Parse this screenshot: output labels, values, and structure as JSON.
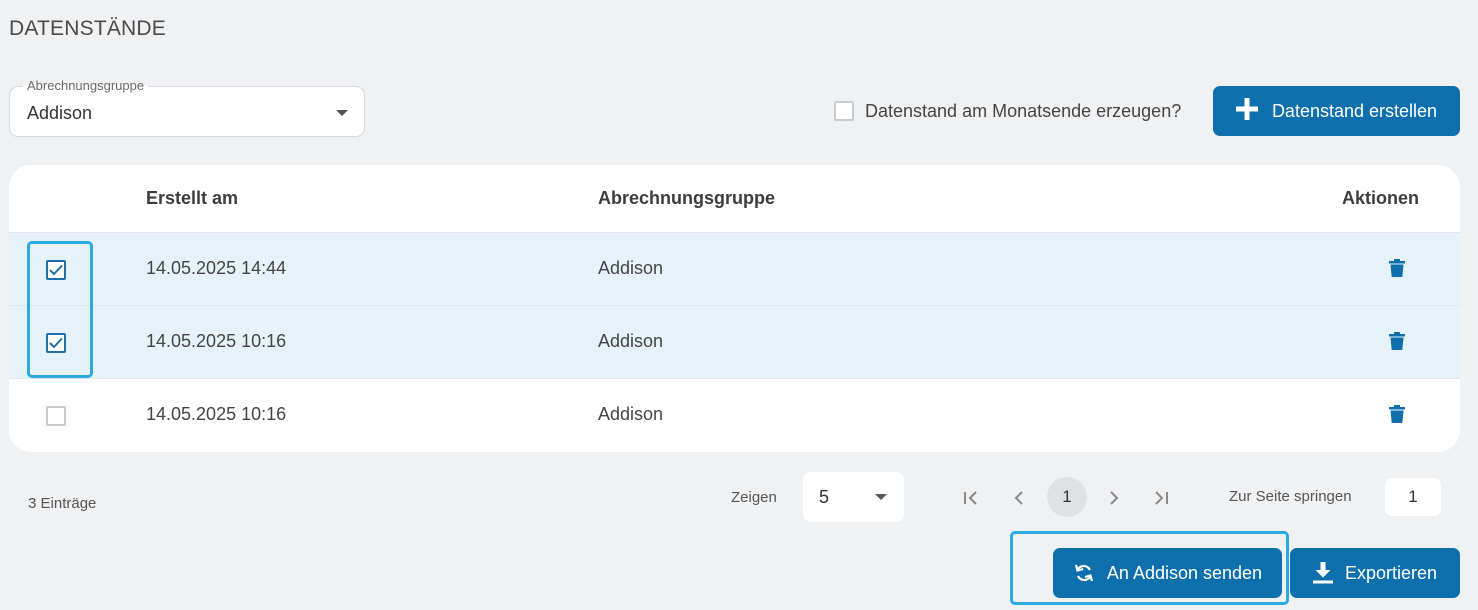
{
  "page_title": "DATENSTÄNDE",
  "group_select": {
    "label": "Abrechnungsgruppe",
    "value": "Addison"
  },
  "monthend_checkbox": {
    "label": "Datenstand am Monatsende erzeugen?",
    "checked": false
  },
  "create_button": {
    "label": "Datenstand erstellen",
    "icon": "plus-icon"
  },
  "table": {
    "headers": {
      "created": "Erstellt am",
      "group": "Abrechnungsgruppe",
      "actions": "Aktionen"
    },
    "rows": [
      {
        "checked": true,
        "created": "14.05.2025 14:44",
        "group": "Addison",
        "action_icon": "trash-icon"
      },
      {
        "checked": true,
        "created": "14.05.2025 10:16",
        "group": "Addison",
        "action_icon": "trash-icon"
      },
      {
        "checked": false,
        "created": "14.05.2025 10:16",
        "group": "Addison",
        "action_icon": "trash-icon"
      }
    ]
  },
  "footer": {
    "entries": "3 Einträge",
    "show_label": "Zeigen",
    "page_size": "5",
    "current_page": "1",
    "jump_label": "Zur Seite springen",
    "jump_value": "1"
  },
  "actions": {
    "send_label": "An Addison senden",
    "send_icon": "sync-icon",
    "export_label": "Exportieren",
    "export_icon": "download-icon"
  },
  "colors": {
    "accent": "#0d6fab",
    "selected_row": "#e6f2fa",
    "highlight": "#29abe2",
    "background": "#f0f1f3"
  }
}
